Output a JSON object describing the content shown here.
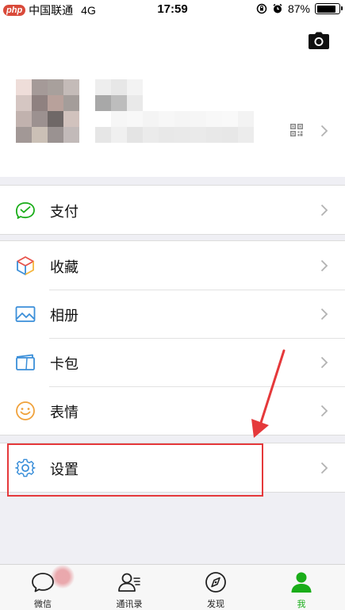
{
  "status_bar": {
    "badge": "php",
    "carrier": "中国联通",
    "network": "4G",
    "time": "17:59",
    "battery": "87%",
    "battery_level": 0.87
  },
  "profile": {
    "camera_icon": "camera-icon",
    "qr_icon": "qr-code-icon"
  },
  "menu": {
    "pay": {
      "label": "支付",
      "icon": "wallet-check-icon",
      "color": "#1aad19"
    },
    "favorites": {
      "label": "收藏",
      "icon": "cube-icon"
    },
    "album": {
      "label": "相册",
      "icon": "image-icon",
      "color": "#3b8fd9"
    },
    "cards": {
      "label": "卡包",
      "icon": "card-icon",
      "color": "#3b8fd9"
    },
    "stickers": {
      "label": "表情",
      "icon": "smiley-icon",
      "color": "#f0a23c"
    },
    "settings": {
      "label": "设置",
      "icon": "gear-icon",
      "color": "#3b8fd9"
    }
  },
  "annotation": {
    "highlight_color": "#e5393b"
  },
  "tabbar": {
    "active_color": "#1aad19",
    "tabs": [
      {
        "label": "微信",
        "icon": "chat-bubble-icon"
      },
      {
        "label": "通讯录",
        "icon": "contacts-icon"
      },
      {
        "label": "发现",
        "icon": "compass-icon"
      },
      {
        "label": "我",
        "icon": "person-icon"
      }
    ]
  }
}
